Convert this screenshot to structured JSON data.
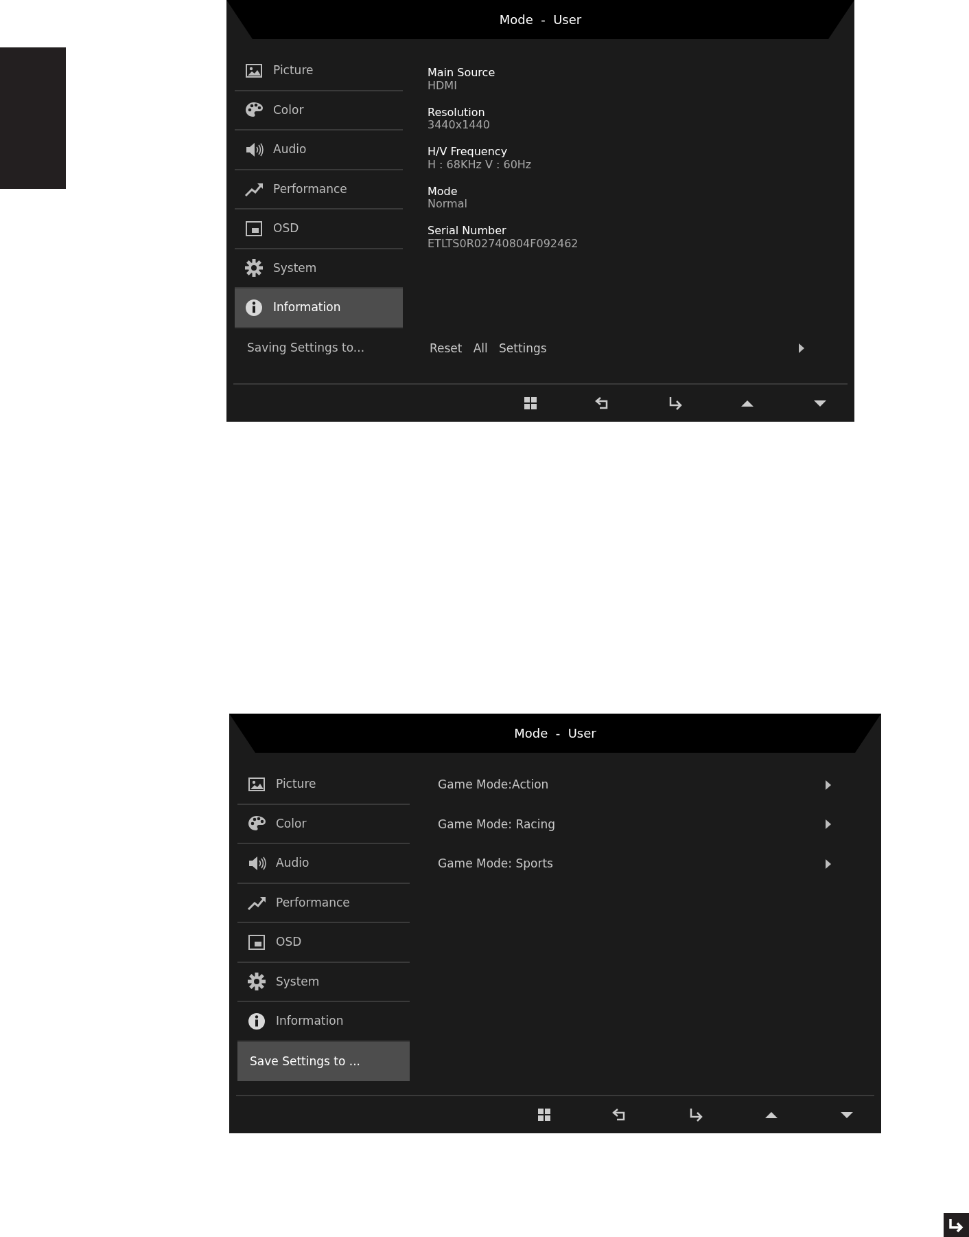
{
  "screens": [
    {
      "title": "Mode  -  User",
      "menu": [
        {
          "label": "Picture",
          "kind": "picture",
          "selected": false
        },
        {
          "label": "Color",
          "kind": "palette",
          "selected": false
        },
        {
          "label": "Audio",
          "kind": "speaker",
          "selected": false
        },
        {
          "label": "Performance",
          "kind": "trend",
          "selected": false
        },
        {
          "label": "OSD",
          "kind": "osd",
          "selected": false
        },
        {
          "label": "System",
          "kind": "gear",
          "selected": false
        },
        {
          "label": "Information",
          "kind": "info",
          "selected": true
        },
        {
          "label": "Saving Settings to...",
          "kind": "text",
          "selected": false
        }
      ],
      "fields": [
        {
          "label": "Main Source",
          "value": "HDMI"
        },
        {
          "label": "Resolution",
          "value": "3440x1440"
        },
        {
          "label": "H/V Frequency",
          "value": "H : 68KHz  V : 60Hz"
        },
        {
          "label": "Mode",
          "value": "Normal"
        },
        {
          "label": "Serial Number",
          "value": "ETLTS0R02740804F092462"
        }
      ],
      "options": [
        {
          "label": "Reset   All   Settings"
        }
      ]
    },
    {
      "title": "Mode  -  User",
      "menu": [
        {
          "label": "Picture",
          "kind": "picture",
          "selected": false
        },
        {
          "label": "Color",
          "kind": "palette",
          "selected": false
        },
        {
          "label": "Audio",
          "kind": "speaker",
          "selected": false
        },
        {
          "label": "Performance",
          "kind": "trend",
          "selected": false
        },
        {
          "label": "OSD",
          "kind": "osd",
          "selected": false
        },
        {
          "label": "System",
          "kind": "gear",
          "selected": false
        },
        {
          "label": "Information",
          "kind": "info",
          "selected": false
        },
        {
          "label": "Save Settings to ...",
          "kind": "text",
          "selected": true
        }
      ],
      "options": [
        {
          "label": "Game Mode:Action"
        },
        {
          "label": "Game Mode: Racing"
        },
        {
          "label": "Game Mode: Sports"
        }
      ]
    }
  ]
}
